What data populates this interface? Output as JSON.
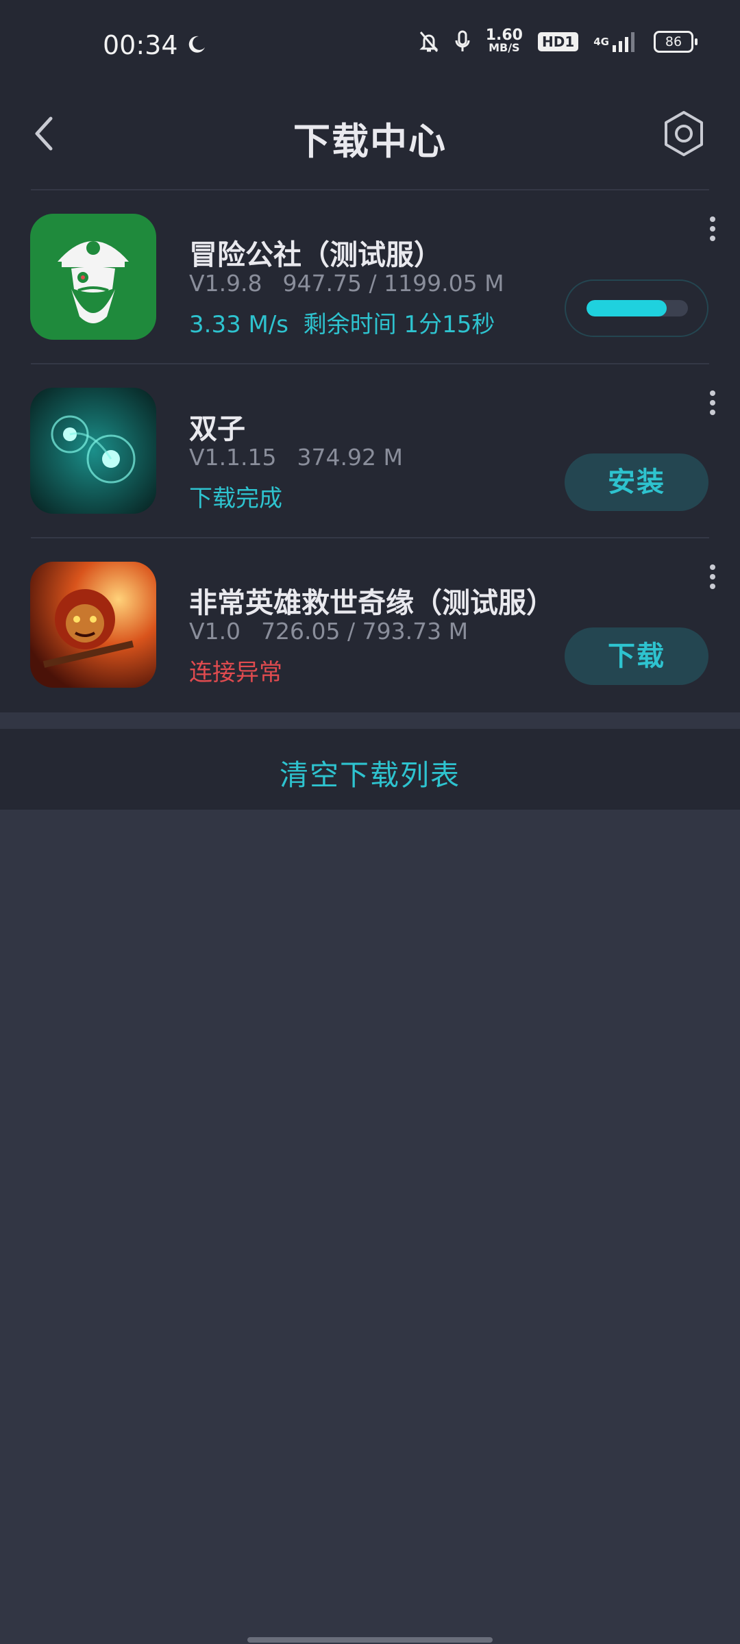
{
  "status_bar": {
    "time": "00:34",
    "net_speed_value": "1.60",
    "net_speed_unit": "MB/S",
    "hd_label": "HD1",
    "network_type": "4G",
    "battery": "86"
  },
  "header": {
    "title": "下载中心"
  },
  "downloads": [
    {
      "name": "冒险公社（测试服）",
      "version": "V1.9.8",
      "size": "947.75 / 1199.05 M",
      "status": "3.33 M/s  剩余时间 1分15秒",
      "progress": 0.79,
      "icon": "pirate-icon"
    },
    {
      "name": "双子",
      "version": "V1.1.15",
      "size": "374.92 M",
      "status": "下载完成",
      "action": "安装",
      "icon": "twin-orbs-icon"
    },
    {
      "name": "非常英雄救世奇缘（测试服）",
      "version": "V1.0",
      "size": "726.05 / 793.73 M",
      "status": "连接异常",
      "action": "下载",
      "icon": "monkey-king-icon"
    }
  ],
  "footer": {
    "clear_label": "清空下载列表"
  },
  "colors": {
    "accent": "#2ec3cf",
    "error": "#e04b4f",
    "background": "#252833"
  }
}
